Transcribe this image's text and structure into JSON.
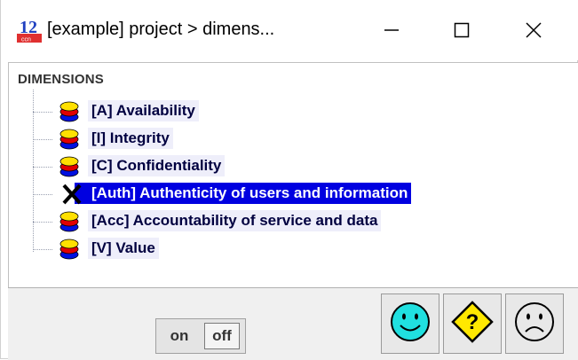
{
  "window": {
    "title": "[example] project > dimens...",
    "icon": "pilar-app-icon",
    "controls": [
      "minimize-icon",
      "maximize-icon",
      "close-icon"
    ]
  },
  "tree": {
    "root_label": "DIMENSIONS",
    "items": [
      {
        "label": "[A] Availability",
        "icon": "layers-icon",
        "selected": false
      },
      {
        "label": "[I] Integrity",
        "icon": "layers-icon",
        "selected": false
      },
      {
        "label": "[C] Confidentiality",
        "icon": "layers-icon",
        "selected": false
      },
      {
        "label": "[Auth] Authenticity of users and information",
        "icon": "cross-icon",
        "selected": true
      },
      {
        "label": "[Acc] Accountability of service and data",
        "icon": "layers-icon",
        "selected": false
      },
      {
        "label": "[V] Value",
        "icon": "layers-icon",
        "selected": false
      }
    ]
  },
  "toolbar": {
    "on_label": "on",
    "off_label": "off",
    "buttons": [
      "happy-face-icon",
      "question-warning-icon",
      "sad-face-icon"
    ]
  },
  "colors": {
    "selection": "#0000e0",
    "layer_yellow": "#ffe000",
    "layer_red": "#e00000",
    "layer_blue": "#0010e0",
    "happy_face": "#20e0e0",
    "warning": "#ffe800"
  }
}
